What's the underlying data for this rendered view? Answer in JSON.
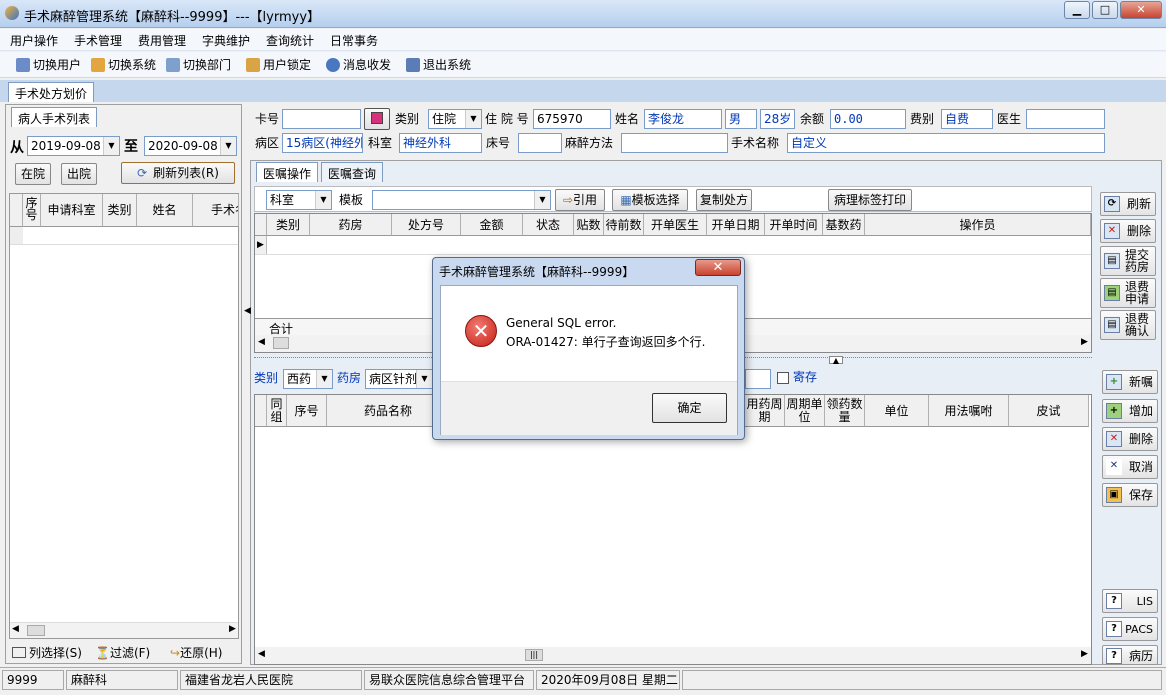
{
  "window": {
    "title": "手术麻醉管理系统【麻醉科--9999】---【lyrmyy】",
    "min": "▁",
    "max": "□",
    "close": "✕"
  },
  "menu": [
    "用户操作",
    "手术管理",
    "费用管理",
    "字典维护",
    "查询统计",
    "日常事务"
  ],
  "toolbar": [
    "切换用户",
    "切换系统",
    "切换部门",
    "用户锁定",
    "消息收发",
    "退出系统"
  ],
  "main_tab": "手术处方划价",
  "left_panel": {
    "tab": "病人手术列表",
    "from_label": "从",
    "from_date": "2019-09-08",
    "to_label": "至",
    "to_date": "2020-09-08",
    "btn_in": "在院",
    "btn_out": "出院",
    "btn_refresh": "刷新列表(R)",
    "columns": [
      "序号",
      "申请科室",
      "类别",
      "姓名",
      "手术名"
    ],
    "bottom": {
      "select": "列选择(S)",
      "filter": "过滤(F)",
      "restore": "还原(H)"
    }
  },
  "patient": {
    "card_label": "卡号",
    "card": "",
    "type_label": "类别",
    "type": "住院",
    "inpatient_label": "住 院 号",
    "inpatient_no": "675970",
    "name_label": "姓名",
    "name": "李俊龙",
    "sex": "男",
    "age": "28岁",
    "balance_label": "余额",
    "balance": "0.00",
    "fee_label": "费别",
    "fee": "自费",
    "doctor_label": "医生",
    "doctor": "",
    "ward_label": "病区",
    "ward": "15病区(神经外",
    "dept_label": "科室",
    "dept": "神经外科",
    "bed_label": "床号",
    "bed": "",
    "anesthesia_label": "麻醉方法",
    "anesthesia": "",
    "surgery_label": "手术名称",
    "surgery": "自定义"
  },
  "order_tabs": [
    "医嘱操作",
    "医嘱查询"
  ],
  "order_toolbar": {
    "dept": "科室",
    "template_label": "模板",
    "template": "",
    "quote": "引用",
    "template_select": "模板选择",
    "copy": "复制处方",
    "print": "病理标签打印"
  },
  "upper_grid": {
    "columns": [
      "类别",
      "药房",
      "处方号",
      "金额",
      "状态",
      "贴数",
      "待前数",
      "开单医生",
      "开单日期",
      "开单时间",
      "基数药",
      "操作员"
    ],
    "total_label": "合计"
  },
  "upper_buttons": [
    "刷新",
    "删除",
    "提交药房",
    "退费申请",
    "退费确认"
  ],
  "lower_filter": {
    "category_label": "类别",
    "category": "西药",
    "pharmacy_label": "药房",
    "pharmacy": "病区针剂",
    "deposit": "寄存"
  },
  "lower_grid": {
    "columns": [
      "同组",
      "序号",
      "药品名称",
      "用药周期",
      "周期单位",
      "领药数量",
      "单位",
      "用法嘱咐",
      "皮试"
    ]
  },
  "lower_buttons": [
    "新嘱",
    "增加",
    "删除",
    "取消",
    "保存"
  ],
  "side_bottom": [
    "LIS",
    "PACS",
    "病历"
  ],
  "status": [
    "9999",
    "麻醉科",
    "福建省龙岩人民医院",
    "易联众医院信息综合管理平台",
    "2020年09月08日 星期二"
  ],
  "dialog": {
    "title": "手术麻醉管理系统【麻醉科--9999】",
    "line1": "General SQL error.",
    "line2": "ORA-01427: 单行子查询返回多个行.",
    "ok": "确定",
    "close": "✕"
  },
  "colors": {
    "accent": "#c5d7ec",
    "error": "#c51f14",
    "bind_blue": "#0038b8"
  }
}
